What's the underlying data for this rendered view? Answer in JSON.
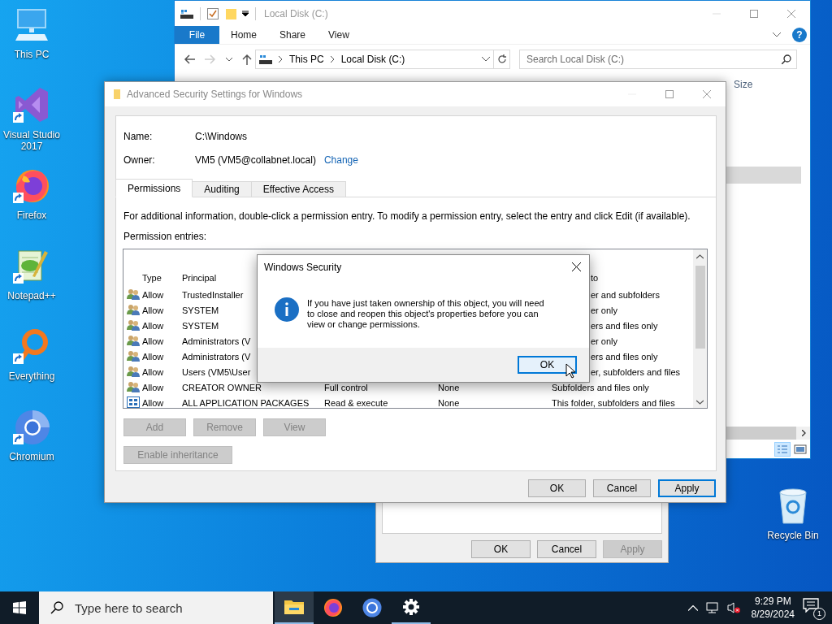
{
  "desktop": {
    "icons": [
      {
        "kind": "pc",
        "label": "This PC",
        "shortcut": false
      },
      {
        "kind": "vs",
        "label": "Visual Studio 2017",
        "shortcut": true
      },
      {
        "kind": "firefox",
        "label": "Firefox",
        "shortcut": true
      },
      {
        "kind": "notepad",
        "label": "Notepad++",
        "shortcut": true
      },
      {
        "kind": "everything",
        "label": "Everything",
        "shortcut": true
      },
      {
        "kind": "chromium",
        "label": "Chromium",
        "shortcut": true
      }
    ],
    "recycle_bin": {
      "label": "Recycle Bin"
    }
  },
  "explorer": {
    "title": "Local Disk (C:)",
    "file_tab": "File",
    "ribbon_tabs": [
      "Home",
      "Share",
      "View"
    ],
    "help": "?",
    "breadcrumb": [
      "This PC",
      "Local Disk (C:)"
    ],
    "search": {
      "placeholder": "Search Local Disk (C:)"
    },
    "columns": [
      "Size"
    ]
  },
  "properties_dialog": {
    "buttons": [
      {
        "label": "OK",
        "disabled": false
      },
      {
        "label": "Cancel",
        "disabled": false
      },
      {
        "label": "Apply",
        "disabled": true
      }
    ]
  },
  "security_window": {
    "title": "Advanced Security Settings for Windows",
    "name_label": "Name:",
    "name_value": "C:\\Windows",
    "owner_label": "Owner:",
    "owner_value": "VM5 (VM5@collabnet.local)",
    "change_link": "Change",
    "tabs": [
      {
        "label": "Permissions",
        "selected": true
      },
      {
        "label": "Auditing",
        "selected": false
      },
      {
        "label": "Effective Access",
        "selected": false
      }
    ],
    "info": "For additional information, double-click a permission entry. To modify a permission entry, select the entry and click Edit (if available).",
    "entries_label": "Permission entries:",
    "table": {
      "columns": [
        "Type",
        "Principal",
        "to"
      ],
      "rows": [
        {
          "kind": "group",
          "type": "Allow",
          "principal": "TrustedInstaller",
          "applies_to": "er and subfolders"
        },
        {
          "kind": "group",
          "type": "Allow",
          "principal": "SYSTEM",
          "applies_to": "er only"
        },
        {
          "kind": "group",
          "type": "Allow",
          "principal": "SYSTEM",
          "applies_to": "ers and files only"
        },
        {
          "kind": "group",
          "type": "Allow",
          "principal": "Administrators (V",
          "applies_to": "er only"
        },
        {
          "kind": "group",
          "type": "Allow",
          "principal": "Administrators (V",
          "applies_to": "ers and files only"
        },
        {
          "kind": "group",
          "type": "Allow",
          "principal": "Users (VM5\\User",
          "applies_to": "er, subfolders and files"
        },
        {
          "kind": "group",
          "type": "Allow",
          "principal": "CREATOR OWNER",
          "access": "Full control",
          "inherited": "None",
          "applies_to": "Subfolders and files only"
        },
        {
          "kind": "package",
          "type": "Allow",
          "principal": "ALL APPLICATION PACKAGES",
          "access": "Read & execute",
          "inherited": "None",
          "applies_to": "This folder, subfolders and files"
        }
      ]
    },
    "entry_buttons": [
      {
        "label": "Add",
        "disabled": true
      },
      {
        "label": "Remove",
        "disabled": true
      },
      {
        "label": "View",
        "disabled": true
      }
    ],
    "inheritance_button": {
      "label": "Enable inheritance",
      "disabled": true
    },
    "buttons": [
      {
        "label": "OK",
        "default": false
      },
      {
        "label": "Cancel",
        "default": false
      },
      {
        "label": "Apply",
        "default": true
      }
    ]
  },
  "message_box": {
    "title": "Windows Security",
    "message": "If you have just taken ownership of this object, you will need to close and reopen this object's properties before you can view or change permissions.",
    "ok": {
      "label": "OK",
      "focused": true
    }
  },
  "taskbar": {
    "search": {
      "placeholder": "Type here to search"
    },
    "apps": [
      {
        "kind": "explorer",
        "active": true,
        "running": true
      },
      {
        "kind": "firefox",
        "active": false,
        "running": false
      },
      {
        "kind": "chromium",
        "active": false,
        "running": false
      },
      {
        "kind": "settings",
        "active": false,
        "running": true
      }
    ],
    "time": "9:29 PM",
    "date": "8/29/2024",
    "notification_count": "1"
  }
}
